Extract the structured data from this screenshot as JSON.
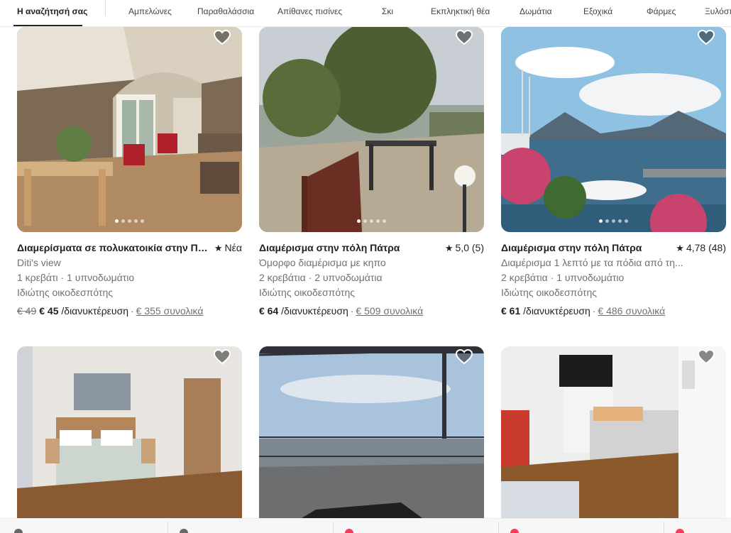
{
  "categories": [
    {
      "label": "Η αναζήτησή σας",
      "active": true
    },
    {
      "label": "Αμπελώνες"
    },
    {
      "label": "Παραθαλάσσια"
    },
    {
      "label": "Απίθανες πισίνες"
    },
    {
      "label": "Σκι"
    },
    {
      "label": "Εκπληκτική θέα"
    },
    {
      "label": "Δωμάτια"
    },
    {
      "label": "Εξοχικά"
    },
    {
      "label": "Φάρμες"
    },
    {
      "label": "Ξυλόσπιτα"
    }
  ],
  "listings": [
    {
      "title": "Διαμερίσματα σε πολυκατοικία στην Πάτρα",
      "rating": "Νέα",
      "line2": "Diti's view",
      "line3": "1 κρεβάτι · 1 υπνοδωμάτιο",
      "line4": "Ιδιώτης οικοδεσπότης",
      "old_price": "€ 49",
      "price": "€ 45",
      "per": "/διανυκτέρευση",
      "sep": "·",
      "total": "€ 355 συνολικά"
    },
    {
      "title": "Διαμέρισμα στην πόλη Πάτρα",
      "rating": "5,0 (5)",
      "line2": "Όμορφο διαμέρισμα με κηπο",
      "line3": "2 κρεβάτια · 2 υπνοδωμάτια",
      "line4": "Ιδιώτης οικοδεσπότης",
      "price": "€ 64",
      "per": "/διανυκτέρευση",
      "sep": "·",
      "total": "€ 509 συνολικά"
    },
    {
      "title": "Διαμέρισμα στην πόλη Πάτρα",
      "rating": "4,78 (48)",
      "line2": "Διαμέρισμα 1 λεπτό με τα πόδια από τη...",
      "line3": "2 κρεβάτια · 1 υπνοδωμάτιο",
      "line4": "Ιδιώτης οικοδεσπότης",
      "price": "€ 61",
      "per": "/διανυκτέρευση",
      "sep": "·",
      "total": "€ 486 συνολικά"
    }
  ],
  "colors": {
    "accent": "#222222",
    "muted": "#717171",
    "brand": "#ff385c"
  },
  "icons": {
    "favorite": "heart-icon",
    "rating": "star-icon"
  }
}
